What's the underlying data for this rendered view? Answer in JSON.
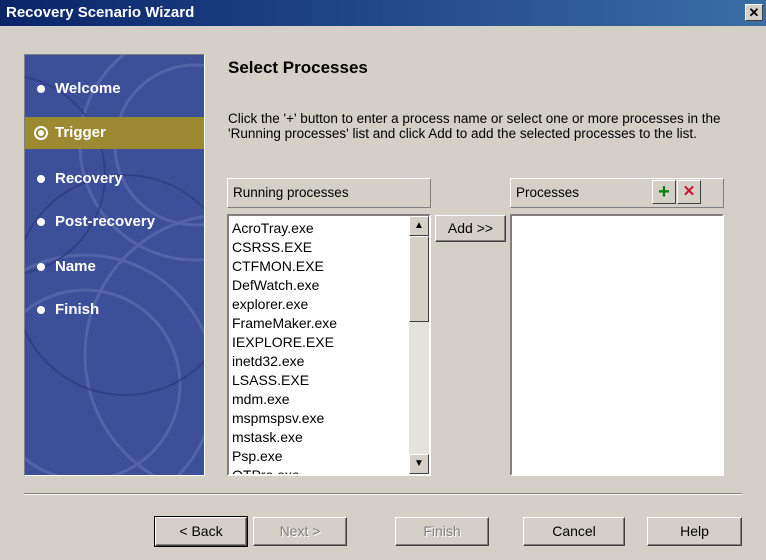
{
  "window": {
    "title": "Recovery Scenario Wizard",
    "close_glyph": "✕"
  },
  "sidebar": {
    "steps": [
      {
        "label": "Welcome",
        "active": false
      },
      {
        "label": "Trigger",
        "active": true
      },
      {
        "label": "Recovery",
        "active": false
      },
      {
        "label": "Post-recovery",
        "active": false
      },
      {
        "label": "Name",
        "active": false
      },
      {
        "label": "Finish",
        "active": false
      }
    ],
    "colors": {
      "background": "#3e4f9a",
      "active": "#9c8a32"
    }
  },
  "page": {
    "title": "Select Processes",
    "instructions": "Click the '+' button to enter a process name or select one or more processes in the 'Running processes' list and click Add to add the selected processes to the list."
  },
  "running_processes": {
    "header": "Running processes",
    "items": [
      "AcroTray.exe",
      "CSRSS.EXE",
      "CTFMON.EXE",
      "DefWatch.exe",
      "explorer.exe",
      "FrameMaker.exe",
      "IEXPLORE.EXE",
      "inetd32.exe",
      "LSASS.EXE",
      "mdm.exe",
      "mspmspsv.exe",
      "mstask.exe",
      "Psp.exe",
      "QTPro.exe"
    ]
  },
  "add_button": {
    "label": "Add >>"
  },
  "processes": {
    "header": "Processes",
    "add_glyph": "+",
    "remove_glyph": "✕",
    "colors": {
      "add": "#008000",
      "remove": "#d01030"
    }
  },
  "footer": {
    "back_label": "< Back",
    "next_label": "Next >",
    "finish_label": "Finish",
    "cancel_label": "Cancel",
    "help_label": "Help"
  }
}
